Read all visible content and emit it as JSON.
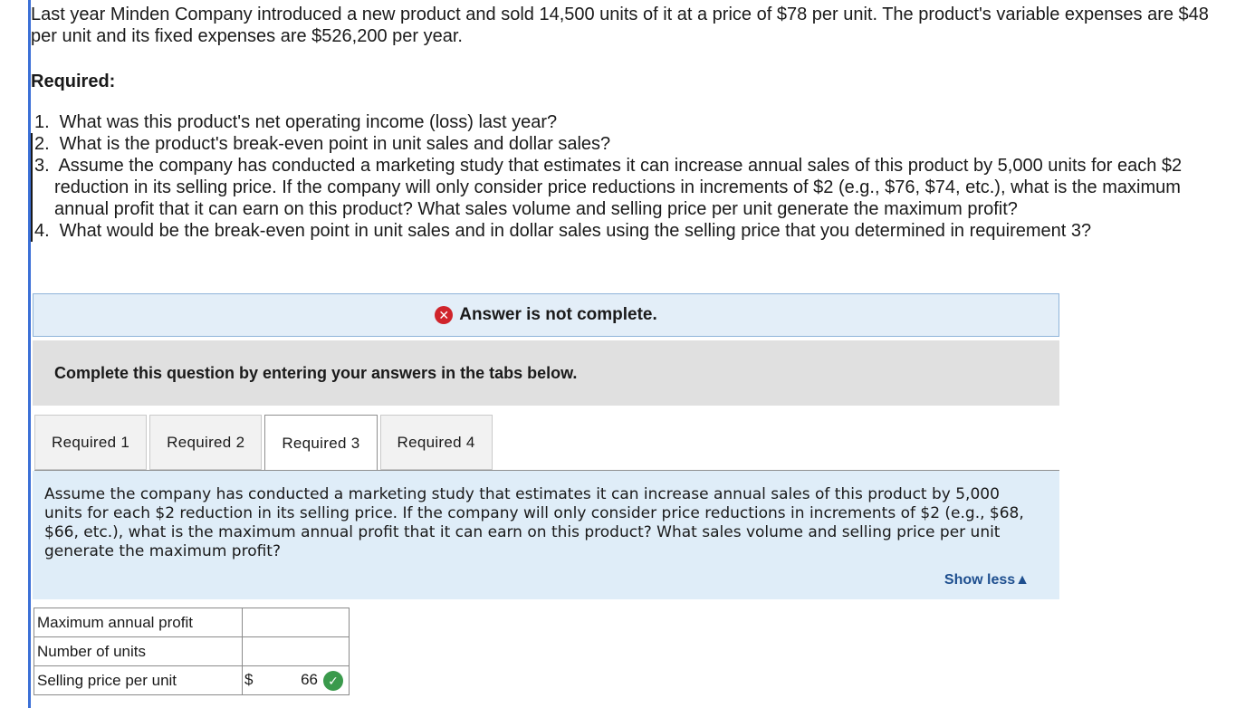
{
  "intro": {
    "text": "Last year Minden Company introduced a new product and sold 14,500 units of it at a price of $78 per unit. The product's variable expenses are $48 per unit and its fixed expenses are $526,200 per year."
  },
  "required_heading": "Required:",
  "requirements": [
    {
      "num": "1.",
      "text": "What was this product's net operating income (loss) last year?"
    },
    {
      "num": "2.",
      "text": "What is the product's break-even point in unit sales and dollar sales?"
    },
    {
      "num": "3.",
      "text": "Assume the company has conducted a marketing study that estimates it can increase annual sales of this product by 5,000 units for each $2 reduction in its selling price. If the company will only consider price reductions in increments of $2 (e.g., $76, $74, etc.), what is the maximum annual profit that it can earn on this product? What sales volume and selling price per unit generate the maximum profit?"
    },
    {
      "num": "4.",
      "text": "What would be the break-even point in unit sales and in dollar sales using the selling price that you determined in requirement 3?"
    }
  ],
  "status": {
    "icon": "x-icon",
    "text": "Answer is not complete.",
    "color": "#d0242b"
  },
  "instruction": "Complete this question by entering your answers in the tabs below.",
  "tabs": [
    {
      "label": "Required 1"
    },
    {
      "label": "Required 2"
    },
    {
      "label": "Required 3",
      "active": true
    },
    {
      "label": "Required 4"
    }
  ],
  "question": {
    "text": "Assume the company has conducted a marketing study that estimates it can increase annual sales of this product by 5,000 units for each $2 reduction in its selling price. If the company will only consider price reductions in increments of $2 (e.g., $68, $66, etc.), what is the maximum annual profit that it can earn on this product? What sales volume and selling price per unit generate the maximum profit?",
    "show_less": "Show less▲"
  },
  "answer_table": {
    "rows": [
      {
        "label": "Maximum annual profit",
        "value": ""
      },
      {
        "label": "Number of units",
        "value": ""
      },
      {
        "label": "Selling price per unit",
        "prefix": "$",
        "value": "66",
        "status_icon": "check-icon"
      }
    ]
  },
  "colors": {
    "accent_blue": "#3b6fd6",
    "panel_blue": "#dfedf8",
    "check_green": "#3a9a4c",
    "link_blue": "#1e4f8f"
  }
}
